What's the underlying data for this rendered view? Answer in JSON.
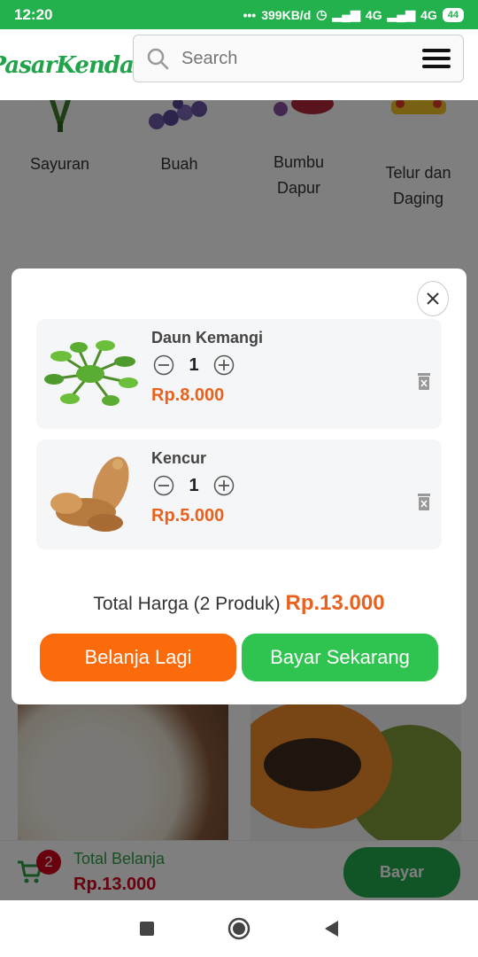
{
  "statusbar": {
    "time": "12:20",
    "dots": "•••",
    "speed": "399KB/d",
    "net1": "4G",
    "net2": "4G",
    "battery": "44"
  },
  "header": {
    "logo_text": "PasarKendari",
    "search_placeholder": "Search"
  },
  "categories": [
    {
      "label": "Sayuran",
      "icon": "vegetable-icon"
    },
    {
      "label": "Buah",
      "icon": "grape-icon"
    },
    {
      "label": "Bumbu\nDapur",
      "icon": "spice-icon"
    },
    {
      "label": "Telur dan\nDaging",
      "icon": "egg-meat-icon"
    }
  ],
  "modal": {
    "items": [
      {
        "name": "Daun Kemangi",
        "qty": "1",
        "price": "Rp.8.000"
      },
      {
        "name": "Kencur",
        "qty": "1",
        "price": "Rp.5.000"
      }
    ],
    "total_label": "Total Harga (2 Produk)",
    "total_value": "Rp.13.000",
    "btn_continue": "Belanja Lagi",
    "btn_pay": "Bayar Sekarang"
  },
  "bottombar": {
    "cart_count": "2",
    "total_label": "Total Belanja",
    "total_value": "Rp.13.000",
    "pay_label": "Bayar"
  },
  "colors": {
    "brand_green": "#22b14c",
    "accent_orange": "#e8621e",
    "button_orange": "#fb6a0b",
    "button_green": "#2ec44f",
    "badge_red": "#d0021b"
  }
}
